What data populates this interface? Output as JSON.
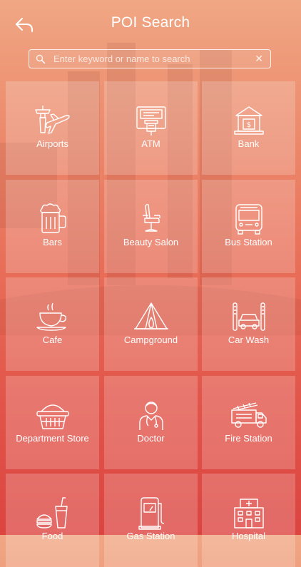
{
  "header": {
    "title": "POI Search",
    "back_icon": "back-arrow-icon"
  },
  "search": {
    "placeholder": "Enter keyword or name to search",
    "value": "",
    "search_icon": "search-icon",
    "clear_icon": "clear-icon",
    "clear_glyph": "✕"
  },
  "categories": [
    {
      "label": "Airports",
      "icon": "airport-icon"
    },
    {
      "label": "ATM",
      "icon": "atm-icon"
    },
    {
      "label": "Bank",
      "icon": "bank-icon"
    },
    {
      "label": "Bars",
      "icon": "beer-mug-icon"
    },
    {
      "label": "Beauty Salon",
      "icon": "salon-chair-icon"
    },
    {
      "label": "Bus Station",
      "icon": "bus-icon"
    },
    {
      "label": "Cafe",
      "icon": "coffee-cup-icon"
    },
    {
      "label": "Campground",
      "icon": "tent-icon"
    },
    {
      "label": "Car Wash",
      "icon": "car-wash-icon"
    },
    {
      "label": "Department Store",
      "icon": "shopping-basket-icon"
    },
    {
      "label": "Doctor",
      "icon": "doctor-icon"
    },
    {
      "label": "Fire Station",
      "icon": "fire-truck-icon"
    },
    {
      "label": "Food",
      "icon": "fast-food-icon"
    },
    {
      "label": "Gas Station",
      "icon": "gas-pump-icon"
    },
    {
      "label": "Hospital",
      "icon": "hospital-icon"
    }
  ],
  "colors": {
    "background_top": "#f0a784",
    "background_bottom": "#dc4440",
    "tile": "rgba(255,255,255,0.20)",
    "text": "#ffffff"
  }
}
